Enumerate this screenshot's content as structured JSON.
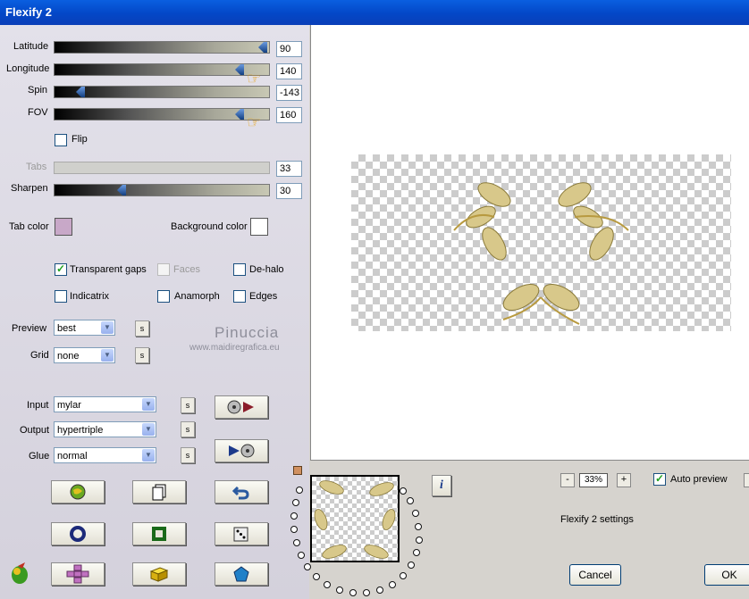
{
  "window": {
    "title": "Flexify 2"
  },
  "sliders": [
    {
      "label": "Latitude",
      "value": "90"
    },
    {
      "label": "Longitude",
      "value": "140"
    },
    {
      "label": "Spin",
      "value": "-143"
    },
    {
      "label": "FOV",
      "value": "160"
    },
    {
      "label": "Tabs",
      "value": "33"
    },
    {
      "label": "Sharpen",
      "value": "30"
    }
  ],
  "flip": {
    "label": "Flip",
    "checked": false
  },
  "colors": {
    "tab_label": "Tab color",
    "tab_color": "#c8a8c8",
    "bg_label": "Background color",
    "bg_color": "#ffffff"
  },
  "checkboxes": [
    {
      "label": "Transparent gaps",
      "checked": true
    },
    {
      "label": "Faces",
      "checked": false,
      "disabled": true
    },
    {
      "label": "De-halo",
      "checked": false
    },
    {
      "label": "Indicatrix",
      "checked": false
    },
    {
      "label": "Anamorph",
      "checked": false
    },
    {
      "label": "Edges",
      "checked": false
    }
  ],
  "preview_select": {
    "label": "Preview",
    "value": "best"
  },
  "grid_select": {
    "label": "Grid",
    "value": "none"
  },
  "input_select": {
    "label": "Input",
    "value": "mylar"
  },
  "output_select": {
    "label": "Output",
    "value": "hypertriple"
  },
  "glue_select": {
    "label": "Glue",
    "value": "normal"
  },
  "s_button_label": "s",
  "signature": {
    "name": "Pinuccia",
    "site": "www.maidiregrafica.eu"
  },
  "zoom": {
    "minus": "-",
    "value": "33%",
    "plus": "+"
  },
  "auto_preview": {
    "label": "Auto preview",
    "checked": true
  },
  "settings_label": "Flexify 2 settings",
  "buttons": {
    "cancel": "Cancel",
    "ok": "OK",
    "info": "i"
  },
  "accent_colors": {
    "title_bar": "#0a5fe0",
    "slider_thumb": "#1a4a90",
    "check_mark": "#21a121"
  }
}
